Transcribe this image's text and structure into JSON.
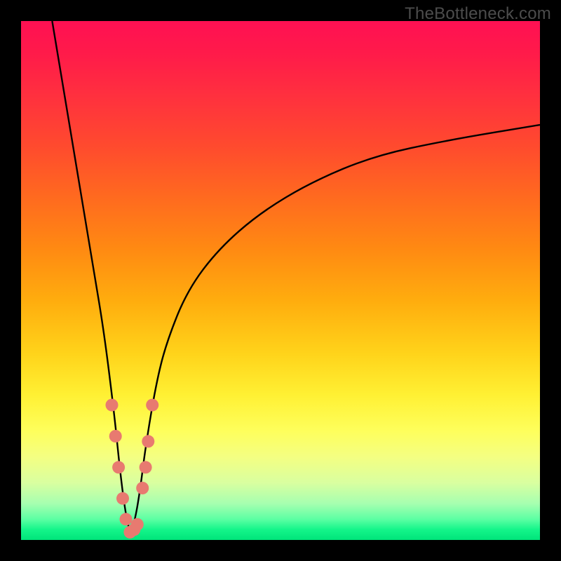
{
  "watermark": "TheBottleneck.com",
  "chart_data": {
    "type": "line",
    "title": "",
    "xlabel": "",
    "ylabel": "",
    "xlim": [
      0,
      100
    ],
    "ylim": [
      0,
      100
    ],
    "grid": false,
    "legend": false,
    "background": "vertical-gradient-red-to-green",
    "series": [
      {
        "name": "bottleneck-curve",
        "description": "V-shaped curve; minimum near x≈21 at y≈0; rises steeply toward y=100 on both sides; right branch approaches y≈80 at x=100",
        "x": [
          6,
          8,
          10,
          12,
          14,
          16,
          18,
          19,
          20,
          21,
          22,
          23,
          24,
          26,
          28,
          32,
          38,
          46,
          56,
          68,
          82,
          100
        ],
        "y": [
          100,
          88,
          76,
          64,
          52,
          40,
          24,
          14,
          6,
          1,
          4,
          10,
          18,
          30,
          38,
          48,
          56,
          63,
          69,
          74,
          77,
          80
        ]
      }
    ],
    "markers": {
      "name": "highlighted-points-near-minimum",
      "color": "#e87a70",
      "points": [
        {
          "x": 17.5,
          "y": 26
        },
        {
          "x": 18.2,
          "y": 20
        },
        {
          "x": 18.8,
          "y": 14
        },
        {
          "x": 19.6,
          "y": 8
        },
        {
          "x": 20.2,
          "y": 4
        },
        {
          "x": 21.0,
          "y": 1.5
        },
        {
          "x": 21.8,
          "y": 2
        },
        {
          "x": 22.4,
          "y": 3
        },
        {
          "x": 23.4,
          "y": 10
        },
        {
          "x": 24.0,
          "y": 14
        },
        {
          "x": 24.5,
          "y": 19
        },
        {
          "x": 25.3,
          "y": 26
        }
      ]
    }
  }
}
